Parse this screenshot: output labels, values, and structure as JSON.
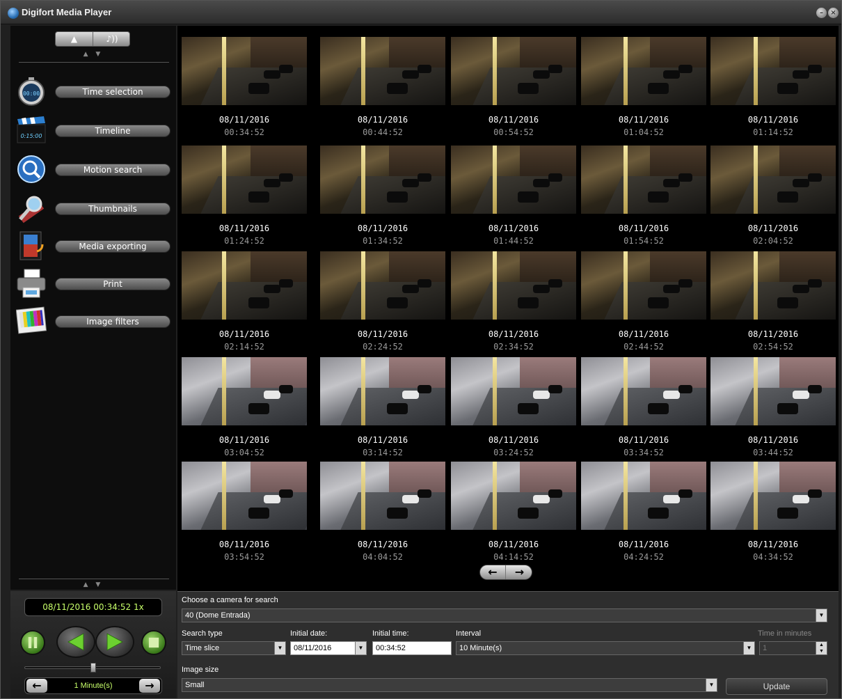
{
  "app": {
    "title": "Digifort Media Player"
  },
  "sidebar": {
    "tools": [
      {
        "label": "Time selection",
        "icon": "stopwatch-icon"
      },
      {
        "label": "Timeline",
        "icon": "clapperboard-icon"
      },
      {
        "label": "Motion search",
        "icon": "motion-search-icon"
      },
      {
        "label": "Thumbnails",
        "icon": "magnifier-film-icon"
      },
      {
        "label": "Media exporting",
        "icon": "film-export-icon"
      },
      {
        "label": "Print",
        "icon": "printer-icon"
      },
      {
        "label": "Image filters",
        "icon": "color-bars-icon"
      }
    ],
    "timeline_icon_text": "0:15:00"
  },
  "playback": {
    "time_display": "08/11/2016 00:34:52 1x",
    "interval_label": "1 Minute(s)",
    "speed_slider_position": 0.5
  },
  "thumbnails": [
    {
      "date": "08/11/2016",
      "time": "00:34:52",
      "scene": "night"
    },
    {
      "date": "08/11/2016",
      "time": "00:44:52",
      "scene": "night"
    },
    {
      "date": "08/11/2016",
      "time": "00:54:52",
      "scene": "night"
    },
    {
      "date": "08/11/2016",
      "time": "01:04:52",
      "scene": "night"
    },
    {
      "date": "08/11/2016",
      "time": "01:14:52",
      "scene": "night"
    },
    {
      "date": "08/11/2016",
      "time": "01:24:52",
      "scene": "night"
    },
    {
      "date": "08/11/2016",
      "time": "01:34:52",
      "scene": "night"
    },
    {
      "date": "08/11/2016",
      "time": "01:44:52",
      "scene": "night"
    },
    {
      "date": "08/11/2016",
      "time": "01:54:52",
      "scene": "night"
    },
    {
      "date": "08/11/2016",
      "time": "02:04:52",
      "scene": "night"
    },
    {
      "date": "08/11/2016",
      "time": "02:14:52",
      "scene": "night"
    },
    {
      "date": "08/11/2016",
      "time": "02:24:52",
      "scene": "night"
    },
    {
      "date": "08/11/2016",
      "time": "02:34:52",
      "scene": "night"
    },
    {
      "date": "08/11/2016",
      "time": "02:44:52",
      "scene": "night"
    },
    {
      "date": "08/11/2016",
      "time": "02:54:52",
      "scene": "night"
    },
    {
      "date": "08/11/2016",
      "time": "03:04:52",
      "scene": "day"
    },
    {
      "date": "08/11/2016",
      "time": "03:14:52",
      "scene": "day"
    },
    {
      "date": "08/11/2016",
      "time": "03:24:52",
      "scene": "day"
    },
    {
      "date": "08/11/2016",
      "time": "03:34:52",
      "scene": "day"
    },
    {
      "date": "08/11/2016",
      "time": "03:44:52",
      "scene": "day"
    },
    {
      "date": "08/11/2016",
      "time": "03:54:52",
      "scene": "day"
    },
    {
      "date": "08/11/2016",
      "time": "04:04:52",
      "scene": "day"
    },
    {
      "date": "08/11/2016",
      "time": "04:14:52",
      "scene": "day"
    },
    {
      "date": "08/11/2016",
      "time": "04:24:52",
      "scene": "day"
    },
    {
      "date": "08/11/2016",
      "time": "04:34:52",
      "scene": "day"
    }
  ],
  "search": {
    "camera_label": "Choose a camera for search",
    "camera_value": "40 (Dome Entrada)",
    "search_type_label": "Search type",
    "search_type_value": "Time slice",
    "initial_date_label": "Initial date:",
    "initial_date_value": "08/11/2016",
    "initial_time_label": "Initial time:",
    "initial_time_value": "00:34:52",
    "interval_label": "Interval",
    "interval_value": "10 Minute(s)",
    "time_in_minutes_label": "Time in minutes",
    "time_in_minutes_value": "1",
    "image_size_label": "Image size",
    "image_size_value": "Small",
    "update_label": "Update"
  }
}
